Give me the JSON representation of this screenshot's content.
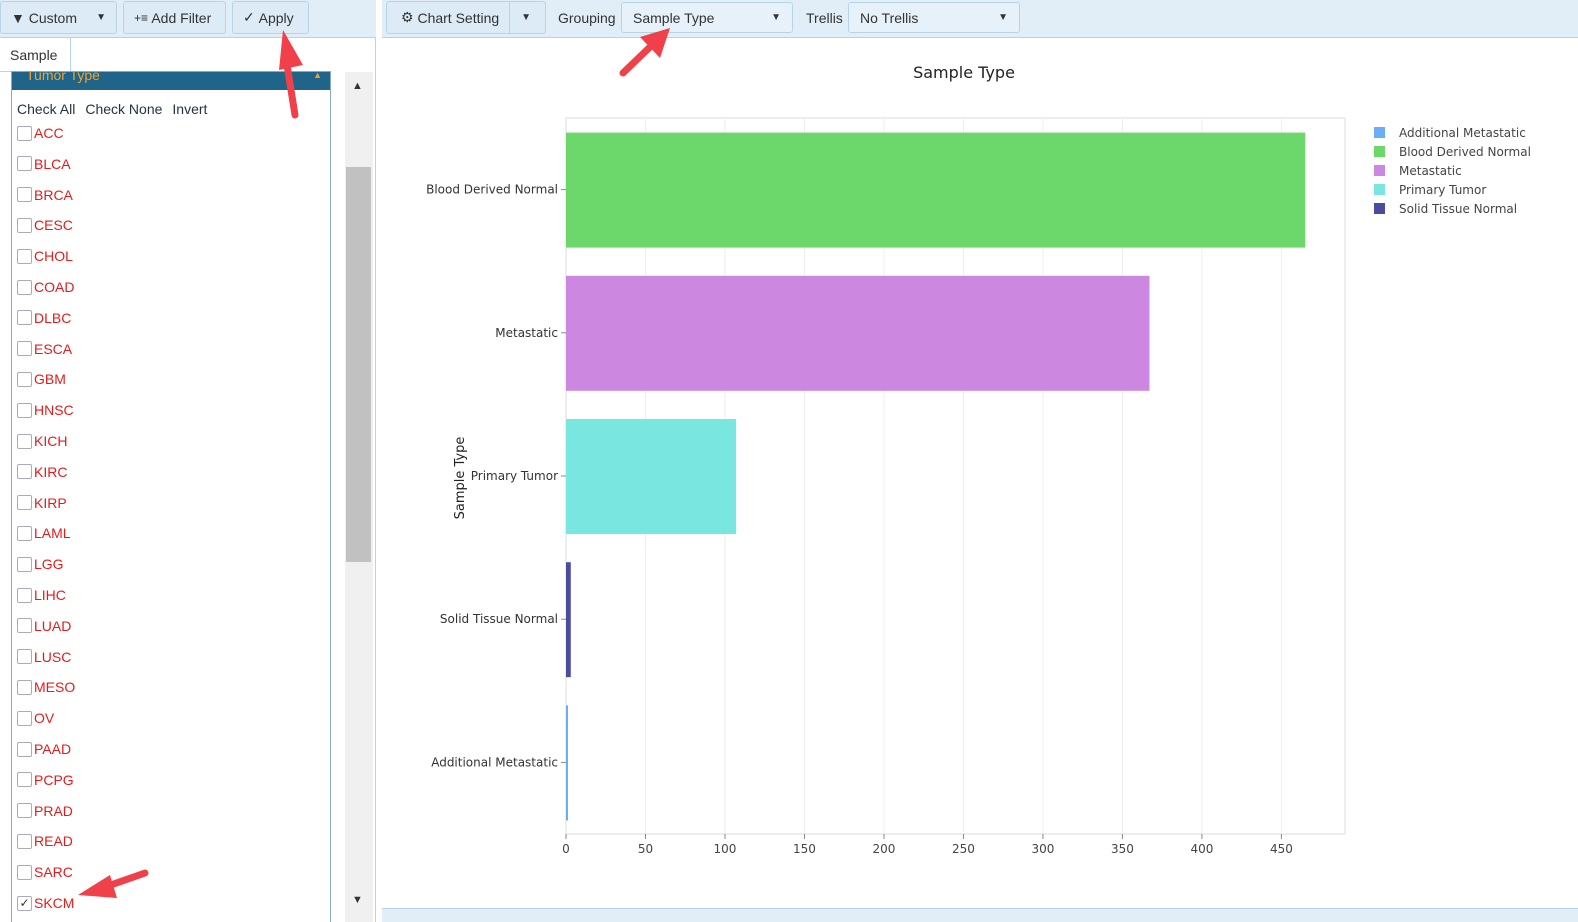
{
  "left_toolbar": {
    "custom": "Custom",
    "add_filter": "Add Filter",
    "apply": "Apply"
  },
  "tab": "Sample",
  "filter": {
    "title": "Tumor Type",
    "check_all": "Check All",
    "check_none": "Check None",
    "invert": "Invert",
    "items": [
      {
        "label": "ACC",
        "checked": false
      },
      {
        "label": "BLCA",
        "checked": false
      },
      {
        "label": "BRCA",
        "checked": false
      },
      {
        "label": "CESC",
        "checked": false
      },
      {
        "label": "CHOL",
        "checked": false
      },
      {
        "label": "COAD",
        "checked": false
      },
      {
        "label": "DLBC",
        "checked": false
      },
      {
        "label": "ESCA",
        "checked": false
      },
      {
        "label": "GBM",
        "checked": false
      },
      {
        "label": "HNSC",
        "checked": false
      },
      {
        "label": "KICH",
        "checked": false
      },
      {
        "label": "KIRC",
        "checked": false
      },
      {
        "label": "KIRP",
        "checked": false
      },
      {
        "label": "LAML",
        "checked": false
      },
      {
        "label": "LGG",
        "checked": false
      },
      {
        "label": "LIHC",
        "checked": false
      },
      {
        "label": "LUAD",
        "checked": false
      },
      {
        "label": "LUSC",
        "checked": false
      },
      {
        "label": "MESO",
        "checked": false
      },
      {
        "label": "OV",
        "checked": false
      },
      {
        "label": "PAAD",
        "checked": false
      },
      {
        "label": "PCPG",
        "checked": false
      },
      {
        "label": "PRAD",
        "checked": false
      },
      {
        "label": "READ",
        "checked": false
      },
      {
        "label": "SARC",
        "checked": false
      },
      {
        "label": "SKCM",
        "checked": true
      }
    ]
  },
  "right_toolbar": {
    "chart_setting": "Chart Setting",
    "grouping_label": "Grouping",
    "grouping_value": "Sample Type",
    "trellis_label": "Trellis",
    "trellis_value": "No Trellis"
  },
  "chart_data": {
    "type": "bar",
    "orientation": "horizontal",
    "title": "Sample Type",
    "ylabel": "Sample Type",
    "xlabel": "",
    "categories": [
      "Blood Derived Normal",
      "Metastatic",
      "Primary Tumor",
      "Solid Tissue Normal",
      "Additional Metastatic"
    ],
    "values": [
      465,
      367,
      107,
      3,
      1
    ],
    "colors": [
      "#6cd86c",
      "#cc88e0",
      "#7ae6e0",
      "#4b4ba0",
      "#6aaef5"
    ],
    "xlim": [
      0,
      490
    ],
    "xticks": [
      0,
      50,
      100,
      150,
      200,
      250,
      300,
      350,
      400,
      450
    ],
    "grid": true,
    "legend_position": "top-right",
    "legend": [
      {
        "label": "Additional Metastatic",
        "color": "#6aaef5"
      },
      {
        "label": "Blood Derived Normal",
        "color": "#6cd86c"
      },
      {
        "label": "Metastatic",
        "color": "#cc88e0"
      },
      {
        "label": "Primary Tumor",
        "color": "#7ae6e0"
      },
      {
        "label": "Solid Tissue Normal",
        "color": "#4b4ba0"
      }
    ]
  }
}
